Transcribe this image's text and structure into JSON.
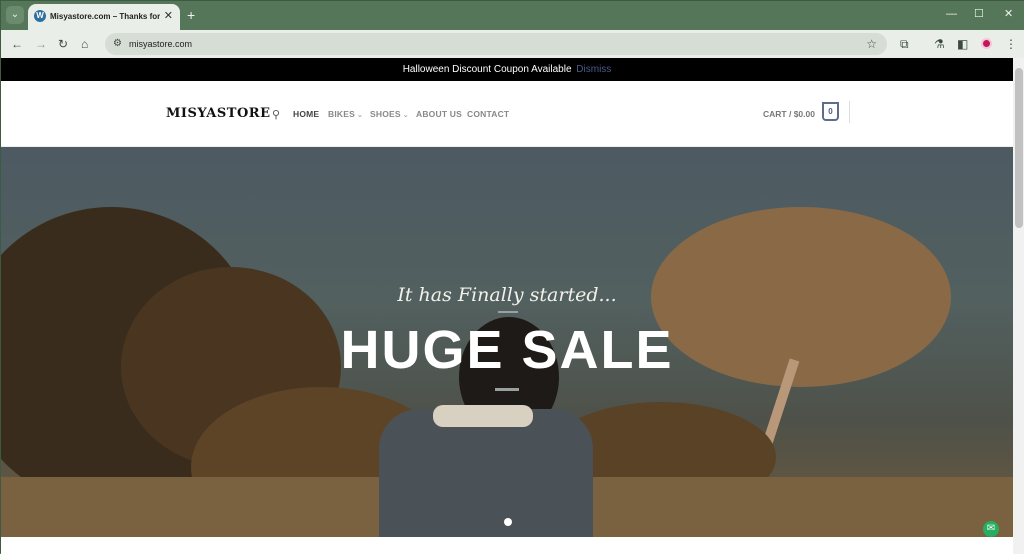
{
  "browser": {
    "tab_title": "Misyastore.com – Thanks for c",
    "favicon_icon": "wordpress-icon",
    "url": "misyastore.com",
    "tab_search_icon": "chevron-down-icon",
    "new_tab_glyph": "+",
    "close_glyph": "✕",
    "minimize_glyph": "—",
    "maximize_glyph": "☐"
  },
  "promo": {
    "text": "Halloween Discount Coupon Available",
    "dismiss": "Dismiss"
  },
  "header": {
    "logo": "MISYASTORE",
    "nav": [
      {
        "label": "HOME",
        "active": true
      },
      {
        "label": "BIKES",
        "has_dropdown": true
      },
      {
        "label": "SHOES",
        "has_dropdown": true
      },
      {
        "label": "ABOUT US"
      },
      {
        "label": "CONTACT"
      }
    ],
    "cart_label": "CART / $0.00",
    "cart_count": "0"
  },
  "hero": {
    "subtitle": "It has Finally started...",
    "title": "HUGE SALE",
    "active_slide": 1,
    "slide_count": 1
  },
  "colors": {
    "browser_frame": "#56765a",
    "promo_bg": "#000000",
    "dismiss_link": "#4a5a8a",
    "cart_accent": "#4a5a80",
    "chat_widget": "#27ae60"
  }
}
